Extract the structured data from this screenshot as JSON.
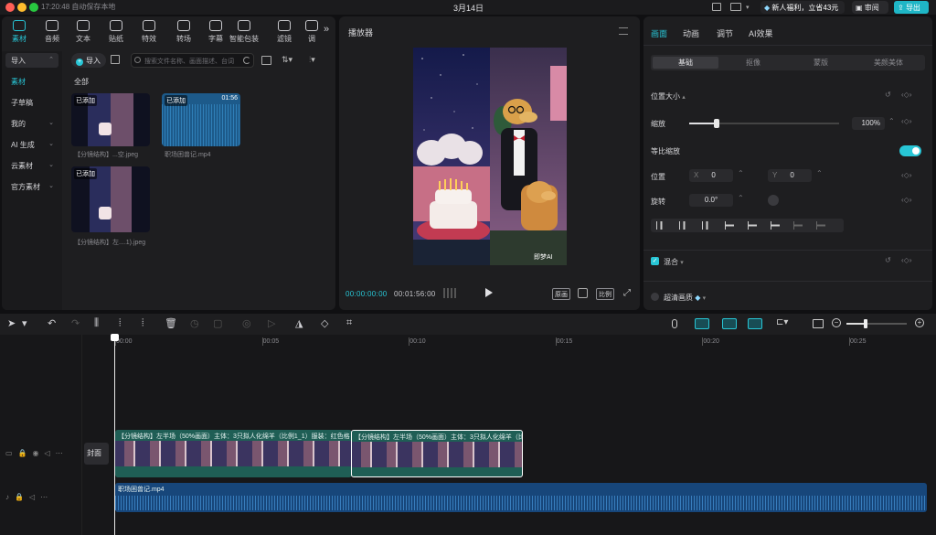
{
  "titlebar": {
    "status": "17:20:48 自动保存本地",
    "date": "3月14日",
    "promo": "新人福利，立省43元",
    "review": "审阅",
    "export": "导出"
  },
  "media": {
    "toolbar": [
      {
        "label": "素材",
        "icon": "media-icon"
      },
      {
        "label": "音频",
        "icon": "audio-icon"
      },
      {
        "label": "文本",
        "icon": "text-icon"
      },
      {
        "label": "贴纸",
        "icon": "sticker-icon"
      },
      {
        "label": "特效",
        "icon": "effects-icon"
      },
      {
        "label": "转场",
        "icon": "transition-icon"
      },
      {
        "label": "字幕",
        "icon": "subtitle-icon"
      },
      {
        "label": "智能包装",
        "icon": "smart-pack-icon"
      },
      {
        "label": "滤镜",
        "icon": "filter-icon"
      },
      {
        "label": "调",
        "icon": "adjust-icon"
      }
    ],
    "sidebar": [
      {
        "label": "导入"
      },
      {
        "label": "素材"
      },
      {
        "label": "子草稿"
      },
      {
        "label": "我的"
      },
      {
        "label": "AI 生成"
      },
      {
        "label": "云素材"
      },
      {
        "label": "官方素材"
      }
    ],
    "import_label": "导入",
    "search_placeholder": "搜索文件名称、画面描述、台词",
    "section": "全部",
    "items": [
      {
        "tag": "已添加",
        "caption": "【分镜结构】...空.jpeg",
        "duration": ""
      },
      {
        "tag": "已添加",
        "caption": "职场困兽记.mp4",
        "duration": "01:56"
      },
      {
        "tag": "已添加",
        "caption": "【分镜结构】左....1).jpeg",
        "duration": ""
      }
    ]
  },
  "player": {
    "title": "播放器",
    "current": "00:00:00:00",
    "total": "00:01:56:00",
    "original": "原画",
    "ratio": "比例",
    "watermark": "即梦AI"
  },
  "props": {
    "tabs": [
      "画面",
      "动画",
      "调节",
      "AI效果"
    ],
    "subtabs": [
      "基础",
      "抠像",
      "蒙版",
      "美颜美体"
    ],
    "position_size": "位置大小",
    "scale_label": "缩放",
    "scale_value": "100%",
    "scale_level": 0.18,
    "uniform_label": "等比缩放",
    "position_label": "位置",
    "x_label": "X",
    "x_value": "0",
    "y_label": "Y",
    "y_value": "0",
    "rotate_label": "旋转",
    "rotate_value": "0.0°",
    "blend_label": "混合",
    "hd_label": "超清画质"
  },
  "timeline": {
    "ticks": [
      "00:00",
      "00:05",
      "00:10",
      "00:15",
      "00:20",
      "00:25"
    ],
    "cover": "封面",
    "clip1": "【分镜结构】左半场（50%画面）主体：3只拟人化绵羊（比例1_1）服装：红色格",
    "clip2": "【分镜结构】左半场（50%画面）主体：3只拟人化绵羊（比",
    "audio": "职场困兽记.mp4"
  },
  "colors": {
    "accent": "#28c6d6",
    "clip": "#1f5e55",
    "audio": "#17467a"
  }
}
